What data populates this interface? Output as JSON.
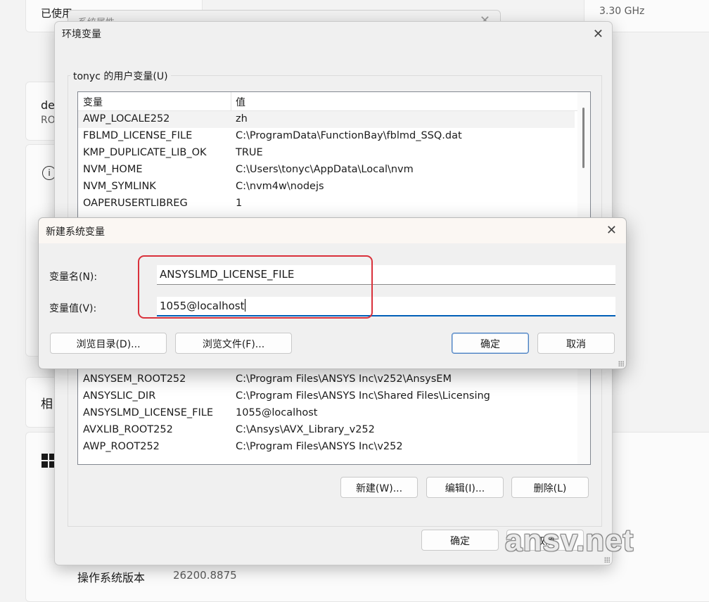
{
  "background": {
    "used_text": "已使用",
    "cpu_speed": "3.30 GHz",
    "device_label_partial": "de",
    "device_sub_partial": "RO",
    "related_partial": "相",
    "os_version_label": "操作系统版本",
    "os_version_value": "26200.8875"
  },
  "system_properties": {
    "title": "系统属性"
  },
  "env_dialog": {
    "title": "环境变量",
    "user_group_label": "tonyc 的用户变量(U)",
    "columns": {
      "variable": "变量",
      "value": "值"
    },
    "user_vars": [
      {
        "name": "AWP_LOCALE252",
        "value": "zh"
      },
      {
        "name": "FBLMD_LICENSE_FILE",
        "value": "C:\\ProgramData\\FunctionBay\\fblmd_SSQ.dat"
      },
      {
        "name": "KMP_DUPLICATE_LIB_OK",
        "value": "TRUE"
      },
      {
        "name": "NVM_HOME",
        "value": "C:\\Users\\tonyc\\AppData\\Local\\nvm"
      },
      {
        "name": "NVM_SYMLINK",
        "value": "C:\\nvm4w\\nodejs"
      },
      {
        "name": "OAPERUSERTLIBREG",
        "value": "1"
      }
    ],
    "system_vars": [
      {
        "name": "ANSYSEM_ROOT252",
        "value": "C:\\Program Files\\ANSYS Inc\\v252\\AnsysEM"
      },
      {
        "name": "ANSYSLIC_DIR",
        "value": "C:\\Program Files\\ANSYS Inc\\Shared Files\\Licensing"
      },
      {
        "name": "ANSYSLMD_LICENSE_FILE",
        "value": "1055@localhost"
      },
      {
        "name": "AVXLIB_ROOT252",
        "value": "C:\\Ansys\\AVX_Library_v252"
      },
      {
        "name": "AWP_ROOT252",
        "value": "C:\\Program Files\\ANSYS Inc\\v252"
      }
    ],
    "buttons": {
      "new": "新建(W)...",
      "edit": "编辑(I)...",
      "delete": "删除(L)",
      "ok": "确定",
      "cancel": "取消"
    }
  },
  "new_var_dialog": {
    "title": "新建系统变量",
    "name_label": "变量名(N):",
    "value_label": "变量值(V):",
    "name_value": "ANSYSLMD_LICENSE_FILE",
    "value_value": "1055@localhost",
    "buttons": {
      "browse_dir": "浏览目录(D)...",
      "browse_file": "浏览文件(F)...",
      "ok": "确定",
      "cancel": "取消"
    }
  },
  "watermark": "ansv.net",
  "colors": {
    "highlight": "#d9313b",
    "accent": "#005fb8"
  }
}
